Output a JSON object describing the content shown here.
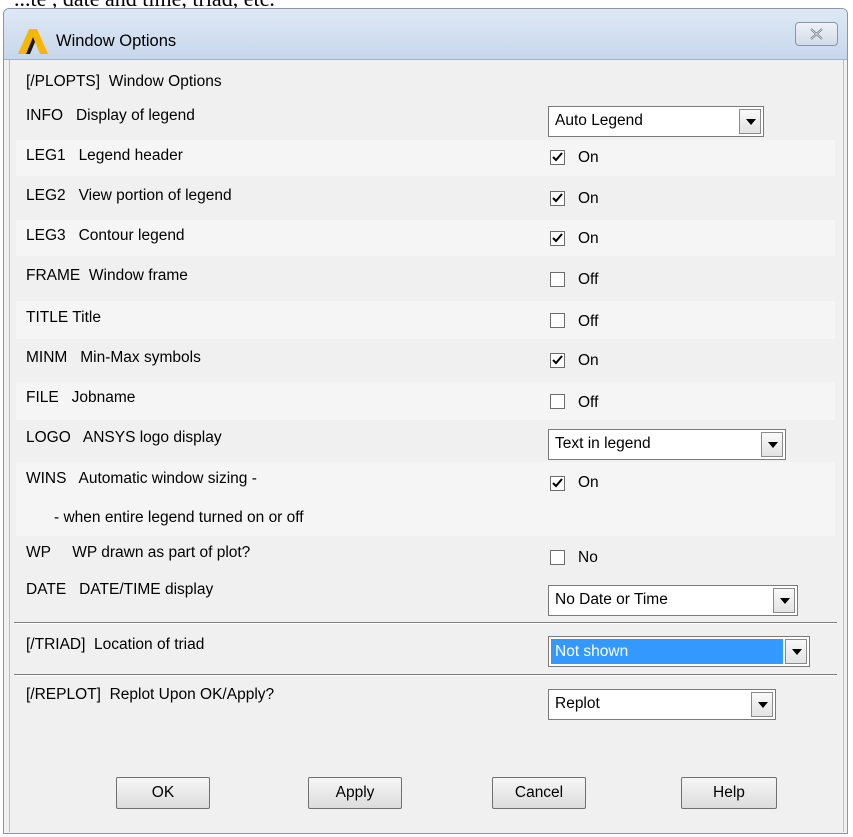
{
  "background_text": "...te , date and time, triad, etc.",
  "window": {
    "title": "Window Options"
  },
  "header": {
    "cmd": "[/PLOPTS]",
    "text": "Window Options"
  },
  "rows": [
    {
      "cmd": "INFO",
      "text": "Display of legend",
      "control": "select",
      "value": "Auto  Legend"
    },
    {
      "cmd": "LEG1",
      "text": "Legend header",
      "control": "checkbox",
      "checked": true,
      "value": "On"
    },
    {
      "cmd": "LEG2",
      "text": "View portion of legend",
      "control": "checkbox",
      "checked": true,
      "value": "On"
    },
    {
      "cmd": "LEG3",
      "text": "Contour legend",
      "control": "checkbox",
      "checked": true,
      "value": "On"
    },
    {
      "cmd": "FRAME",
      "text": "Window frame",
      "control": "checkbox",
      "checked": false,
      "value": "Off"
    },
    {
      "cmd": "TITLE",
      "text": "Title",
      "control": "checkbox",
      "checked": false,
      "value": "Off"
    },
    {
      "cmd": "MINM",
      "text": "Min-Max symbols",
      "control": "checkbox",
      "checked": true,
      "value": "On"
    },
    {
      "cmd": "FILE",
      "text": "Jobname",
      "control": "checkbox",
      "checked": false,
      "value": "Off"
    },
    {
      "cmd": "LOGO",
      "text": "ANSYS logo display",
      "control": "select",
      "value": "Text in legend"
    },
    {
      "cmd": "WINS",
      "text": "Automatic window sizing -",
      "control": "checkbox",
      "checked": true,
      "value": "On"
    },
    {
      "cmd": "",
      "text": "- when entire legend turned on or off",
      "control": "none"
    },
    {
      "cmd": "WP",
      "text": "WP drawn as part of plot?",
      "control": "checkbox",
      "checked": false,
      "value": "No"
    },
    {
      "cmd": "DATE",
      "text": "DATE/TIME display",
      "control": "select",
      "value": "No Date or Time"
    }
  ],
  "triad": {
    "cmd": "[/TRIAD]",
    "text": "Location of triad",
    "value": "Not shown"
  },
  "replot": {
    "cmd": "[/REPLOT]",
    "text": "Replot Upon OK/Apply?",
    "value": "Replot"
  },
  "buttons": {
    "ok": "OK",
    "apply": "Apply",
    "cancel": "Cancel",
    "help": "Help"
  },
  "colors": {
    "highlight": "#3399ff",
    "titlebar": "#c7d7ec",
    "logo": "#f5b800"
  }
}
